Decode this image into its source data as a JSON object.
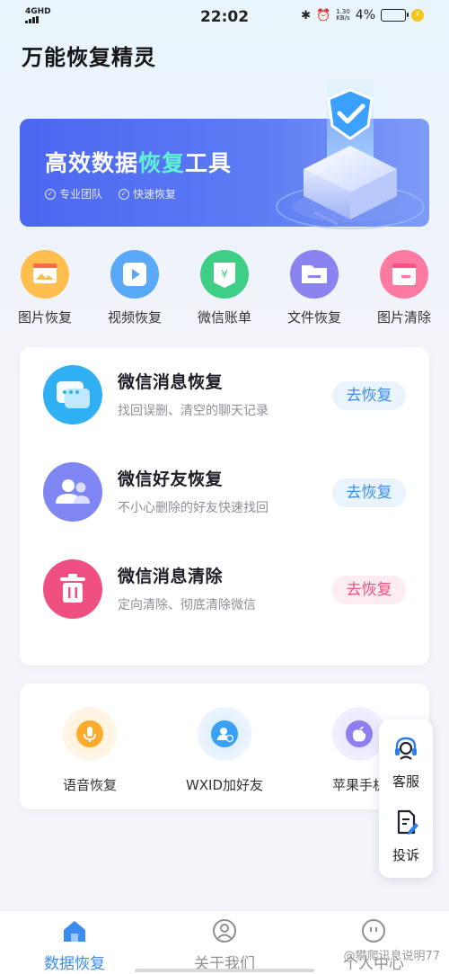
{
  "status_bar": {
    "network": "4GHD",
    "time": "22:02",
    "speed_value": "1.30",
    "speed_unit": "KB/s",
    "battery": "4%"
  },
  "app": {
    "title": "万能恢复精灵"
  },
  "banner": {
    "title_part1": "高效数据",
    "title_highlight": "恢复",
    "title_part2": "工具",
    "tags": [
      "专业团队",
      "快速恢复"
    ],
    "highlight_color": "#5ff0d6"
  },
  "quick_actions": [
    {
      "label": "图片恢复",
      "icon": "image-icon",
      "color": "#ffbe4d"
    },
    {
      "label": "视频恢复",
      "icon": "video-icon",
      "color": "#5aa8f8"
    },
    {
      "label": "微信账单",
      "icon": "bill-icon",
      "color": "#3fce86"
    },
    {
      "label": "文件恢复",
      "icon": "folder-icon",
      "color": "#8a83f0"
    },
    {
      "label": "图片清除",
      "icon": "image-clear-icon",
      "color": "#ff7aa0"
    }
  ],
  "features": [
    {
      "title": "微信消息恢复",
      "desc": "找回误删、清空的聊天记录",
      "button": "去恢复",
      "icon": "chat-icon",
      "color": "#2fb0f2"
    },
    {
      "title": "微信好友恢复",
      "desc": "不小心删除的好友快速找回",
      "button": "去恢复",
      "icon": "friends-icon",
      "color": "#7d86f2"
    },
    {
      "title": "微信消息清除",
      "desc": "定向清除、彻底清除微信",
      "button": "去恢复",
      "icon": "trash-icon",
      "color": "#f0507f"
    }
  ],
  "tools": [
    {
      "label": "语音恢复",
      "icon": "microphone-icon",
      "color": "#ffab2e"
    },
    {
      "label": "WXID加好友",
      "icon": "add-friend-icon",
      "color": "#3aa0f5"
    },
    {
      "label": "苹果手机",
      "icon": "apple-icon",
      "color": "#8d7ff2"
    }
  ],
  "float_panel": {
    "service": "客服",
    "complaint": "投诉"
  },
  "tabs": [
    {
      "label": "数据恢复",
      "active": true
    },
    {
      "label": "关于我们",
      "active": false
    },
    {
      "label": "个人中心",
      "active": false
    }
  ],
  "watermark": "@攀爬讯息说明77",
  "colors": {
    "accent": "#3c8cf0",
    "banner": "#4c67f0"
  }
}
